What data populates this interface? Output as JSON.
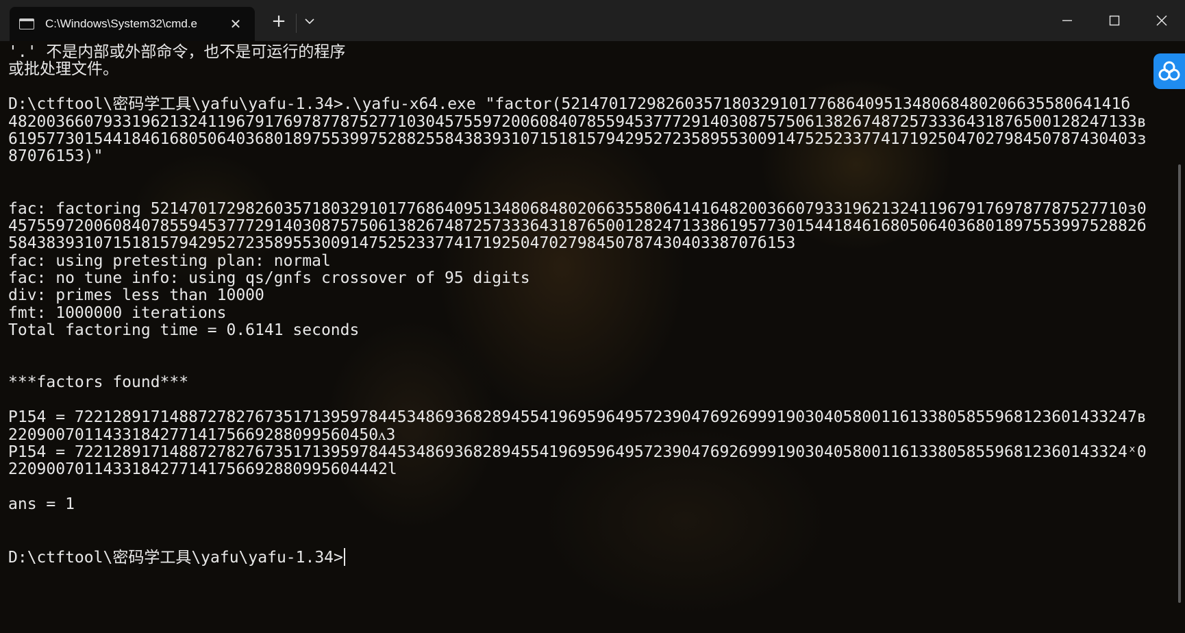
{
  "tab": {
    "title": "C:\\Windows\\System32\\cmd.e",
    "icon": "terminal-icon"
  },
  "toolbar": {
    "new_tab": "+",
    "close_tab": "✕"
  },
  "terminal": {
    "lines": [
      "'.' 不是内部或外部命令，也不是可运行的程序",
      "或批处理文件。",
      "",
      "D:\\ctftool\\密码学工具\\yafu\\yafu-1.34>.\\yafu-x64.exe \"factor(52147017298260357180329101776864095134806848020663558064141б",
      "48200366079331962132411967917697877875277103045755972006084078559453777291403087575061382674872573336431876500128247133в",
      "61957730154418461680506403680189755399752882558438393107151815794295272358955300914752523377417192504702798450787430403з",
      "87076153)\"",
      "",
      "",
      "fac: factoring 5214701729826035718032910177686409513480684802066355806414164820036607933196213241196791769787787527710з0",
      "45755972006084078559453777291403087575061382674872573336431876500128247133861957730154418461680506403680189755399752882б",
      "5843839310715181579429527235895530091475252337741719250470279845078743040338707б153",
      "fac: using pretesting plan: normal",
      "fac: no tune info: using qs/gnfs crossover of 95 digits",
      "div: primes less than 10000",
      "fmt: 1000000 iterations",
      "Total factoring time = 0.6141 seconds",
      "",
      "",
      "***factors found***",
      "",
      "P154 = 7221289171488727827673517139597844534869368289455419695964957239047692699919030405800116133805855968123601433247в",
      "220900701143318427714175669288099560450ᴧ3",
      "P154 = 722128917148872782767351713959784453486936828945541969596495723904769269991903040580011613380585596812360143324ˣ0",
      "2209007011433184277141756692880995604442l",
      "",
      "ans = 1",
      "",
      "",
      "D:\\ctftool\\密码学工具\\yafu\\yafu-1.34>"
    ]
  }
}
